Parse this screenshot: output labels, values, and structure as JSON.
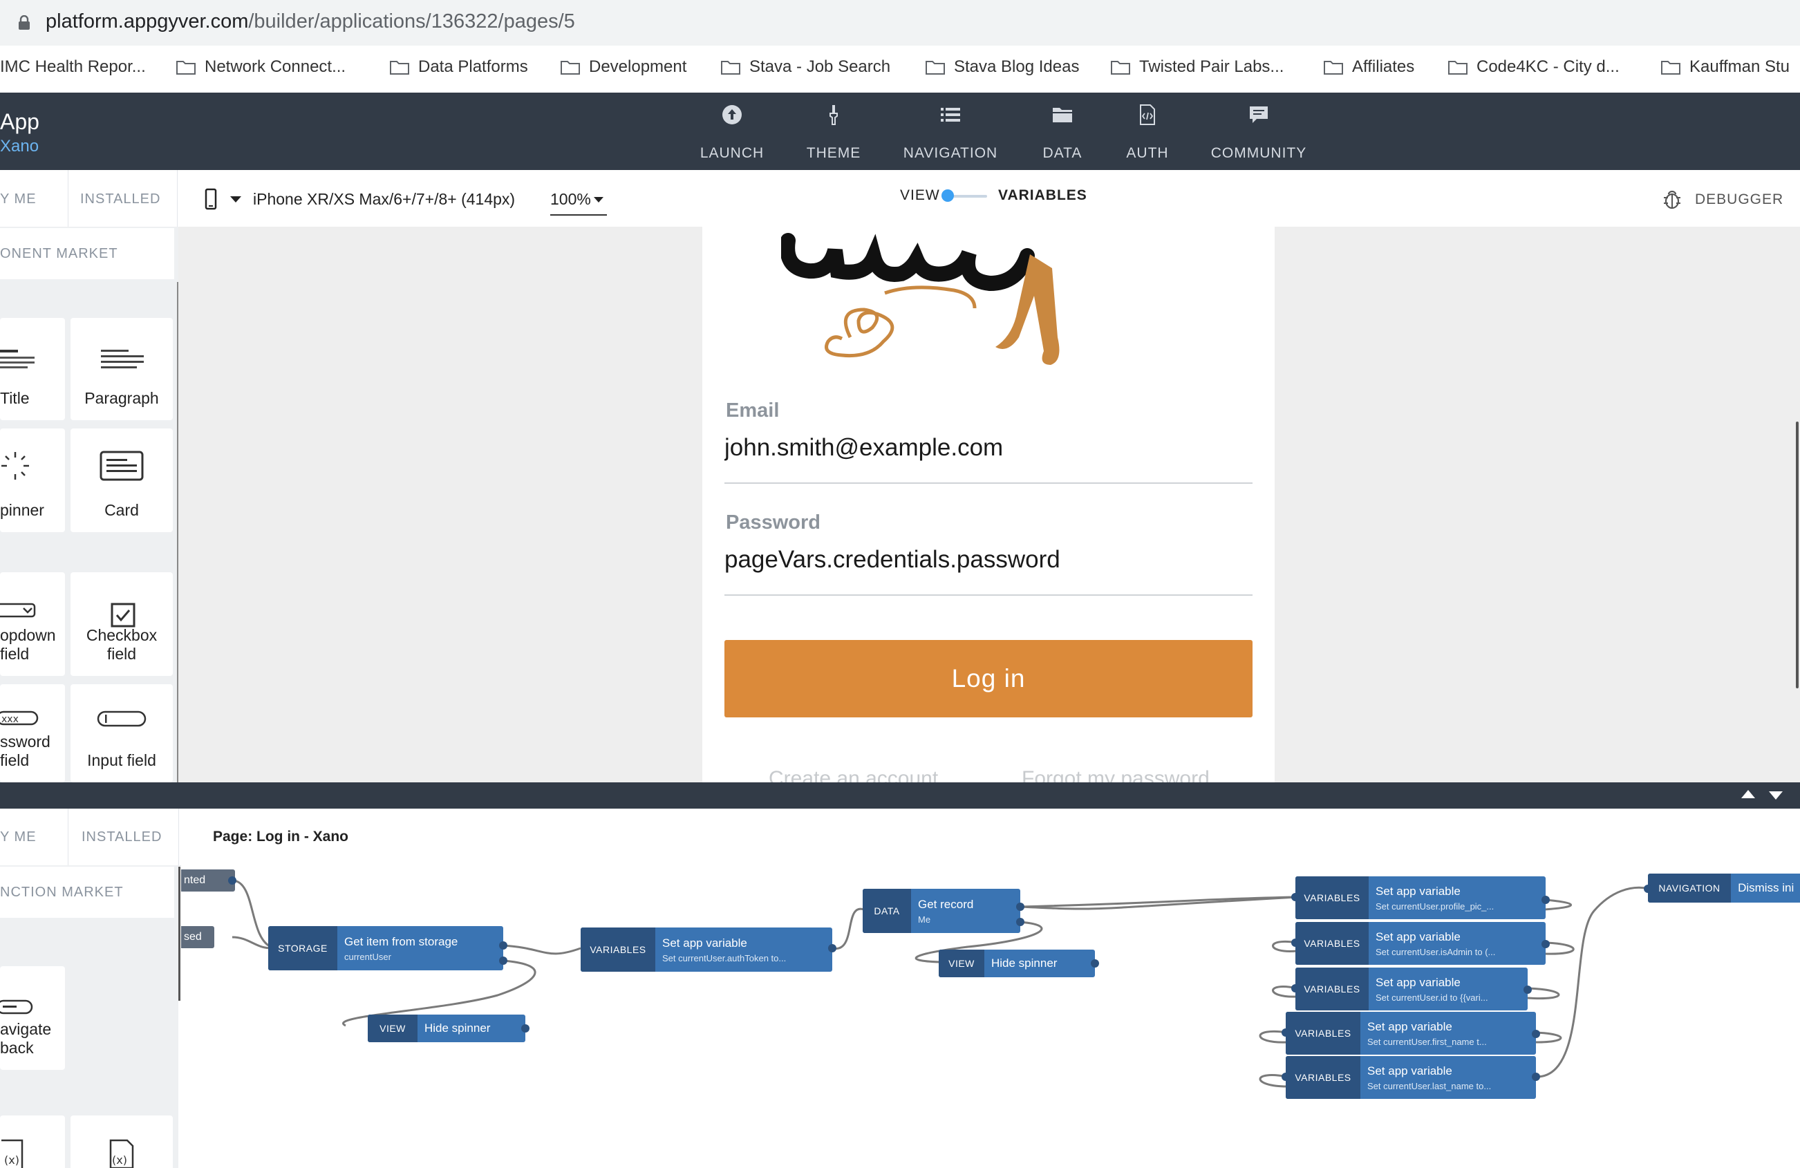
{
  "browser": {
    "url_host": "platform.appgyver.com",
    "url_path": "/builder/applications/136322/pages/5",
    "bookmarks": [
      "IMC Health Repor...",
      "Network Connect...",
      "Data Platforms",
      "Development",
      "Stava - Job Search",
      "Stava Blog Ideas",
      "Twisted Pair Labs...",
      "Affiliates",
      "Code4KC - City d...",
      "Kauffman Stu"
    ]
  },
  "app": {
    "title": "App",
    "subtitle": "Xano",
    "nav": [
      "LAUNCH",
      "THEME",
      "NAVIGATION",
      "DATA",
      "AUTH",
      "COMMUNITY"
    ]
  },
  "toolbar": {
    "tab_try": "Y ME",
    "tab_installed": "INSTALLED",
    "device": "iPhone XR/XS Max/6+/7+/8+ (414px)",
    "zoom": "100%",
    "view_label": "VIEW",
    "variables_label": "VARIABLES",
    "debugger": "DEBUGGER"
  },
  "components": {
    "market": "ONENT MARKET",
    "items": [
      "Title",
      "Paragraph",
      "pinner",
      "Card",
      "opdown\nfield",
      "Checkbox\nfield",
      "ssword\nfield",
      "Input field"
    ]
  },
  "login": {
    "email_label": "Email",
    "email_value": "john.smith@example.com",
    "password_label": "Password",
    "password_value": "pageVars.credentials.password",
    "button": "Log in",
    "create_account": "Create an account",
    "forgot_password": "Forgot my password"
  },
  "logic": {
    "tab_try": "Y ME",
    "tab_installed": "INSTALLED",
    "page_title": "Page: Log in - Xano",
    "market": "NCTION MARKET",
    "functions": [
      "avigate\nback"
    ],
    "partial_top": "nted",
    "partial_mid": "sed",
    "nodes": {
      "storage": {
        "type": "STORAGE",
        "title": "Get item from storage",
        "sub": "currentUser"
      },
      "hide1": {
        "type": "VIEW",
        "title": "Hide spinner"
      },
      "setvar1": {
        "type": "VARIABLES",
        "title": "Set app variable",
        "sub": "Set currentUser.authToken to..."
      },
      "getrecord": {
        "type": "DATA",
        "title": "Get record",
        "sub": "Me"
      },
      "hide2": {
        "type": "VIEW",
        "title": "Hide spinner"
      },
      "v1": {
        "type": "VARIABLES",
        "title": "Set app variable",
        "sub": "Set currentUser.profile_pic_..."
      },
      "v2": {
        "type": "VARIABLES",
        "title": "Set app variable",
        "sub": "Set currentUser.isAdmin to (..."
      },
      "v3": {
        "type": "VARIABLES",
        "title": "Set app variable",
        "sub": "Set currentUser.id to {{vari..."
      },
      "v4": {
        "type": "VARIABLES",
        "title": "Set app variable",
        "sub": "Set currentUser.first_name t..."
      },
      "v5": {
        "type": "VARIABLES",
        "title": "Set app variable",
        "sub": "Set currentUser.last_name to..."
      },
      "nav": {
        "type": "NAVIGATION",
        "title": "Dismiss ini"
      }
    }
  }
}
